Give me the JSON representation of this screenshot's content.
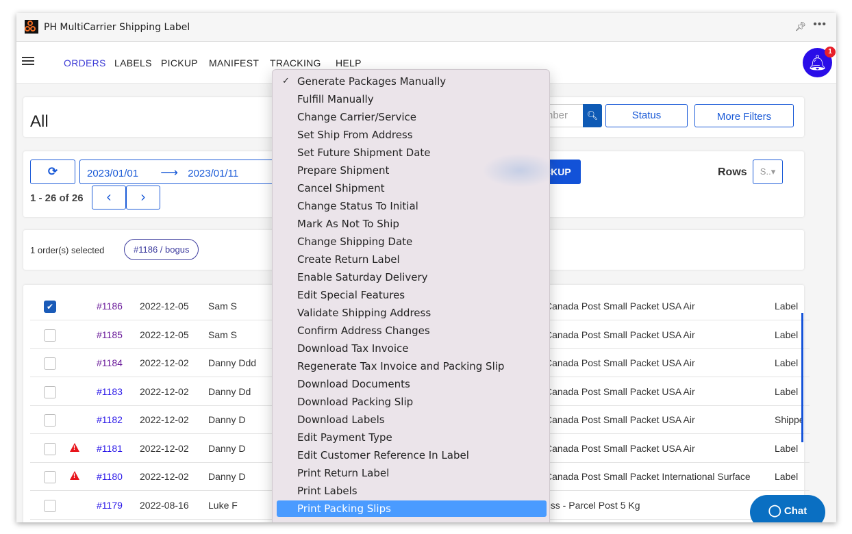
{
  "window": {
    "title": "PH MultiCarrier Shipping Label",
    "pin_icon": "pin-icon",
    "more_icon": "more-icon"
  },
  "nav": {
    "items": [
      "ORDERS",
      "LABELS",
      "PICKUP",
      "MANIFEST",
      "TRACKING",
      "HELP"
    ],
    "active": "ORDERS",
    "notification_count": "1",
    "active_color": "#3d3cd6"
  },
  "filters": {
    "title": "All",
    "search_placeholder": "nber",
    "status_label": "Status",
    "more_filters_label": "More Filters"
  },
  "toolbar": {
    "date_from": "2023/01/01",
    "date_arrow": "⟶",
    "date_to": "2023/01/11",
    "pickup_label": "CKUP",
    "rows_label": "Rows",
    "rows_value": "S..",
    "pagination": "1 - 26 of 26",
    "prev": "‹",
    "next": "›"
  },
  "selection": {
    "text": "1 order(s) selected",
    "chip": "#1186 / bogus"
  },
  "menu": {
    "items": [
      "Generate Packages Manually",
      "Fulfill Manually",
      "Change Carrier/Service",
      "Set Ship From Address",
      "Set Future Shipment Date",
      "Prepare Shipment",
      "Cancel Shipment",
      "Change Status To Initial",
      "Mark As Not To Ship",
      "Change Shipping Date",
      "Create Return Label",
      "Enable Saturday Delivery",
      "Edit Special Features",
      "Validate Shipping Address",
      "Confirm Address Changes",
      "Download Tax Invoice",
      "Regenerate Tax Invoice and Packing Slip",
      "Download Documents",
      "Download Packing Slip",
      "Download Labels",
      "Edit Payment Type",
      "Edit Customer Reference In Label",
      "Print Return Label",
      "Print Labels",
      "Print Packing Slips"
    ],
    "checked": "Generate Packages Manually",
    "highlighted": "Print Packing Slips"
  },
  "orders": [
    {
      "checked": true,
      "warning": false,
      "visited": true,
      "order": "#1186",
      "date": "2022-12-05",
      "name": "Sam S",
      "service": "Canada Post Small Packet USA Air",
      "status": "Label"
    },
    {
      "checked": false,
      "warning": false,
      "visited": true,
      "order": "#1185",
      "date": "2022-12-05",
      "name": "Sam S",
      "service": "Canada Post Small Packet USA Air",
      "status": "Label"
    },
    {
      "checked": false,
      "warning": false,
      "visited": true,
      "order": "#1184",
      "date": "2022-12-02",
      "name": "Danny Ddd",
      "service": "Canada Post Small Packet USA Air",
      "status": "Label"
    },
    {
      "checked": false,
      "warning": false,
      "visited": false,
      "order": "#1183",
      "date": "2022-12-02",
      "name": "Danny Dd",
      "service": "Canada Post Small Packet USA Air",
      "status": "Label"
    },
    {
      "checked": false,
      "warning": false,
      "visited": false,
      "order": "#1182",
      "date": "2022-12-02",
      "name": "Danny D",
      "service": "Canada Post Small Packet USA Air",
      "status": "Shippe"
    },
    {
      "checked": false,
      "warning": true,
      "visited": false,
      "order": "#1181",
      "date": "2022-12-02",
      "name": "Danny D",
      "service": "Canada Post Small Packet USA Air",
      "status": "Label"
    },
    {
      "checked": false,
      "warning": true,
      "visited": false,
      "order": "#1180",
      "date": "2022-12-02",
      "name": "Danny D",
      "service": "Canada Post Small Packet International Surface",
      "status": "Label"
    },
    {
      "checked": false,
      "warning": false,
      "visited": false,
      "order": "#1179",
      "date": "2022-08-16",
      "name": "Luke F",
      "service": "ess - Parcel Post 5 Kg",
      "status": ""
    }
  ],
  "chat": {
    "label": "Chat"
  }
}
